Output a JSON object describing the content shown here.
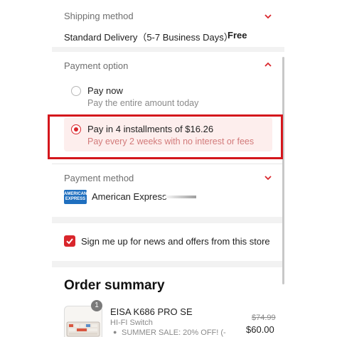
{
  "shipping": {
    "title": "Shipping method",
    "delivery": "Standard Delivery（5-7 Business Days）",
    "separator": "·",
    "price": "Free"
  },
  "payment_option": {
    "title": "Payment option",
    "options": [
      {
        "label": "Pay now",
        "sub": "Pay the entire amount today",
        "selected": false
      },
      {
        "label": "Pay in 4 installments of $16.26",
        "sub": "Pay every 2 weeks with no interest or fees",
        "selected": true
      }
    ]
  },
  "payment_method": {
    "title": "Payment method",
    "card_logo_text": "AMERICAN EXPRESS",
    "card_name": "American Express"
  },
  "newsletter": {
    "label": "Sign me up for news and offers from this store",
    "checked": true
  },
  "order_summary": {
    "title": "Order summary",
    "item": {
      "quantity": "1",
      "name": "EISA K686 PRO SE",
      "variant": "HI-FI Switch",
      "discount": "SUMMER SALE: 20% OFF! (-",
      "original_price": "$74.99",
      "price": "$60.00"
    }
  },
  "colors": {
    "accent": "#d9262c",
    "highlight_bg": "#fdeeed",
    "annotation_outline": "#d4161c",
    "amex_blue": "#1f6fbf"
  }
}
